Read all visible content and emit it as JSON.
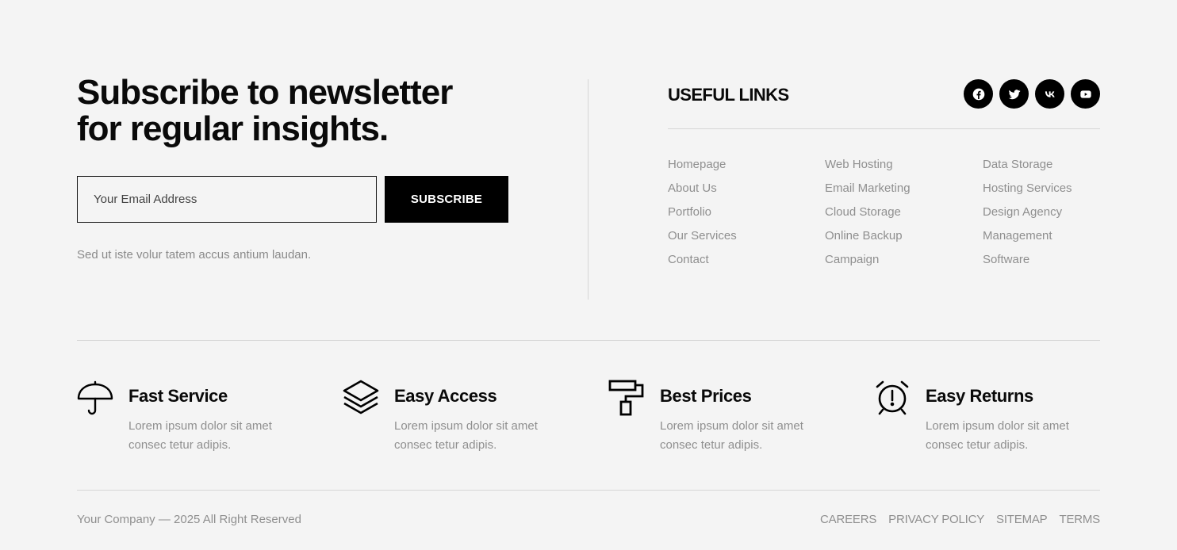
{
  "newsletter": {
    "title_line1": "Subscribe to newsletter",
    "title_line2": "for regular insights.",
    "email_placeholder": "Your Email Address",
    "subscribe_label": "SUBSCRIBE",
    "note": "Sed ut iste volur tatem accus antium laudan."
  },
  "useful_links": {
    "title": "USEFUL LINKS",
    "socials": [
      {
        "icon": "facebook-icon"
      },
      {
        "icon": "twitter-icon"
      },
      {
        "icon": "vk-icon"
      },
      {
        "icon": "youtube-icon"
      }
    ],
    "columns": [
      [
        "Homepage",
        "About Us",
        "Portfolio",
        "Our Services",
        "Contact"
      ],
      [
        "Web Hosting",
        "Email Marketing",
        "Cloud Storage",
        "Online Backup",
        "Campaign"
      ],
      [
        "Data Storage",
        "Hosting Services",
        "Design Agency",
        "Management",
        "Software"
      ]
    ]
  },
  "features": [
    {
      "icon": "umbrella-icon",
      "title": "Fast Service",
      "line1": "Lorem ipsum dolor sit amet",
      "line2": "consec tetur adipis."
    },
    {
      "icon": "layers-icon",
      "title": "Easy Access",
      "line1": "Lorem ipsum dolor sit amet",
      "line2": "consec tetur adipis."
    },
    {
      "icon": "paint-roller-icon",
      "title": "Best Prices",
      "line1": "Lorem ipsum dolor sit amet",
      "line2": "consec tetur adipis."
    },
    {
      "icon": "alarm-clock-icon",
      "title": "Easy Returns",
      "line1": "Lorem ipsum dolor sit amet",
      "line2": "consec tetur adipis."
    }
  ],
  "footer": {
    "copyright": "Your Company — 2025 All Right Reserved",
    "nav": [
      "CAREERS",
      "PRIVACY POLICY",
      "SITEMAP",
      "TERMS"
    ]
  },
  "colors": {
    "background": "#f4f4f4",
    "text_dark": "#0a0a0a",
    "text_muted": "#8f8f8f",
    "button_bg": "#000000",
    "divider": "#d6d6d6"
  }
}
